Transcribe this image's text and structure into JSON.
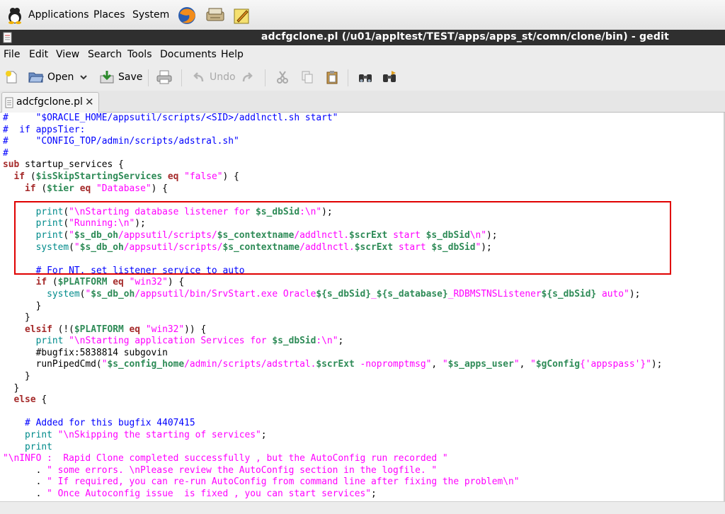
{
  "panel": {
    "menus": [
      "Applications",
      "Places",
      "System"
    ],
    "launchers": [
      "firefox-icon",
      "network-icon",
      "notes-icon"
    ]
  },
  "window": {
    "title": "adcfgclone.pl (/u01/appltest/TEST/apps/apps_st/comn/clone/bin) - gedit"
  },
  "menubar": [
    "File",
    "Edit",
    "View",
    "Search",
    "Tools",
    "Documents",
    "Help"
  ],
  "toolbar": {
    "open_label": "Open",
    "save_label": "Save",
    "undo_label": "Undo"
  },
  "tab": {
    "label": "adcfgclone.pl",
    "close": "✕"
  },
  "code_lines": [
    [
      [
        "c",
        "#     \"$ORACLE_HOME/appsutil/scripts/<SID>/addlnctl.sh start\""
      ]
    ],
    [
      [
        "c",
        "#  if appsTier:"
      ]
    ],
    [
      [
        "c",
        "#     \"CONFIG_TOP/admin/scripts/adstral.sh\""
      ]
    ],
    [
      [
        "c",
        "#"
      ]
    ],
    [
      [
        "k",
        "sub"
      ],
      [
        "n",
        " startup_services {"
      ]
    ],
    [
      [
        "n",
        "  "
      ],
      [
        "k",
        "if"
      ],
      [
        "n",
        " ("
      ],
      [
        "v",
        "$isSkipStartingServices"
      ],
      [
        "n",
        " "
      ],
      [
        "k",
        "eq"
      ],
      [
        "n",
        " "
      ],
      [
        "s",
        "\"false\""
      ],
      [
        "n",
        ") {"
      ]
    ],
    [
      [
        "n",
        "    "
      ],
      [
        "k",
        "if"
      ],
      [
        "n",
        " ("
      ],
      [
        "v",
        "$tier"
      ],
      [
        "n",
        " "
      ],
      [
        "k",
        "eq"
      ],
      [
        "n",
        " "
      ],
      [
        "s",
        "\"Database\""
      ],
      [
        "n",
        ") {"
      ]
    ],
    [
      [
        "n",
        ""
      ]
    ],
    [
      [
        "n",
        "      "
      ],
      [
        "f",
        "print"
      ],
      [
        "n",
        "("
      ],
      [
        "s",
        "\"\\nStarting database listener for "
      ],
      [
        "v",
        "$s_dbSid"
      ],
      [
        "s",
        ":\\n\""
      ],
      [
        "n",
        ");"
      ]
    ],
    [
      [
        "n",
        "      "
      ],
      [
        "f",
        "print"
      ],
      [
        "n",
        "("
      ],
      [
        "s",
        "\"Running:\\n\""
      ],
      [
        "n",
        ");"
      ]
    ],
    [
      [
        "n",
        "      "
      ],
      [
        "f",
        "print"
      ],
      [
        "n",
        "("
      ],
      [
        "s",
        "\""
      ],
      [
        "v",
        "$s_db_oh"
      ],
      [
        "s",
        "/appsutil/scripts/"
      ],
      [
        "v",
        "$s_contextname"
      ],
      [
        "s",
        "/addlnctl."
      ],
      [
        "v",
        "$scrExt"
      ],
      [
        "s",
        " start "
      ],
      [
        "v",
        "$s_dbSid"
      ],
      [
        "s",
        "\\n\""
      ],
      [
        "n",
        ");"
      ]
    ],
    [
      [
        "n",
        "      "
      ],
      [
        "f",
        "system"
      ],
      [
        "n",
        "("
      ],
      [
        "s",
        "\""
      ],
      [
        "v",
        "$s_db_oh"
      ],
      [
        "s",
        "/appsutil/scripts/"
      ],
      [
        "v",
        "$s_contextname"
      ],
      [
        "s",
        "/addlnctl."
      ],
      [
        "v",
        "$scrExt"
      ],
      [
        "s",
        " start "
      ],
      [
        "v",
        "$s_dbSid"
      ],
      [
        "s",
        "\""
      ],
      [
        "n",
        ");"
      ]
    ],
    [
      [
        "n",
        ""
      ]
    ],
    [
      [
        "n",
        "      "
      ],
      [
        "c",
        "# For NT, set listener service to auto"
      ]
    ],
    [
      [
        "n",
        "      "
      ],
      [
        "k",
        "if"
      ],
      [
        "n",
        " ("
      ],
      [
        "v",
        "$PLATFORM"
      ],
      [
        "n",
        " "
      ],
      [
        "k",
        "eq"
      ],
      [
        "n",
        " "
      ],
      [
        "s",
        "\"win32\""
      ],
      [
        "n",
        ") {"
      ]
    ],
    [
      [
        "n",
        "        "
      ],
      [
        "f",
        "system"
      ],
      [
        "n",
        "("
      ],
      [
        "s",
        "\""
      ],
      [
        "v",
        "$s_db_oh"
      ],
      [
        "s",
        "/appsutil/bin/SrvStart.exe Oracle"
      ],
      [
        "v",
        "${s_dbSid}"
      ],
      [
        "s",
        "_"
      ],
      [
        "v",
        "${s_database}"
      ],
      [
        "s",
        "_RDBMSTNSListener"
      ],
      [
        "v",
        "${s_dbSid}"
      ],
      [
        "s",
        " auto\""
      ],
      [
        "n",
        ");"
      ]
    ],
    [
      [
        "n",
        "      }"
      ]
    ],
    [
      [
        "n",
        "    }"
      ]
    ],
    [
      [
        "n",
        "    "
      ],
      [
        "k",
        "elsif"
      ],
      [
        "n",
        " (!("
      ],
      [
        "v",
        "$PLATFORM"
      ],
      [
        "n",
        " "
      ],
      [
        "k",
        "eq"
      ],
      [
        "n",
        " "
      ],
      [
        "s",
        "\"win32\""
      ],
      [
        "n",
        ")) {"
      ]
    ],
    [
      [
        "n",
        "      "
      ],
      [
        "f",
        "print"
      ],
      [
        "n",
        " "
      ],
      [
        "s",
        "\"\\nStarting application Services for "
      ],
      [
        "v",
        "$s_dbSid"
      ],
      [
        "s",
        ":\\n\""
      ],
      [
        "n",
        ";"
      ]
    ],
    [
      [
        "n",
        "      "
      ],
      [
        "n",
        "#bugfix:5838814 subgovin"
      ]
    ],
    [
      [
        "n",
        "      runPipedCmd("
      ],
      [
        "s",
        "\""
      ],
      [
        "v",
        "$s_config_home"
      ],
      [
        "s",
        "/admin/scripts/adstrtal."
      ],
      [
        "v",
        "$scrExt"
      ],
      [
        "s",
        " -nopromptmsg\""
      ],
      [
        "n",
        ", "
      ],
      [
        "s",
        "\""
      ],
      [
        "v",
        "$s_apps_user"
      ],
      [
        "s",
        "\""
      ],
      [
        "n",
        ", "
      ],
      [
        "s",
        "\""
      ],
      [
        "v",
        "$gConfig"
      ],
      [
        "s",
        "{'appspass'}\""
      ],
      [
        "n",
        ");"
      ]
    ],
    [
      [
        "n",
        "    }"
      ]
    ],
    [
      [
        "n",
        "  }"
      ]
    ],
    [
      [
        "n",
        "  "
      ],
      [
        "k",
        "else"
      ],
      [
        "n",
        " {"
      ]
    ],
    [
      [
        "n",
        ""
      ]
    ],
    [
      [
        "n",
        "    "
      ],
      [
        "c",
        "# Added for this bugfix 4407415"
      ]
    ],
    [
      [
        "n",
        "    "
      ],
      [
        "f",
        "print"
      ],
      [
        "n",
        " "
      ],
      [
        "s",
        "\"\\nSkipping the starting of services\""
      ],
      [
        "n",
        ";"
      ]
    ],
    [
      [
        "n",
        "    "
      ],
      [
        "f",
        "print"
      ]
    ],
    [
      [
        "s",
        "\"\\nINFO :  Rapid Clone completed successfully , but the AutoConfig run recorded \""
      ]
    ],
    [
      [
        "n",
        "      . "
      ],
      [
        "s",
        "\" some errors. \\nPlease review the AutoConfig section in the logfile. \""
      ]
    ],
    [
      [
        "n",
        "      . "
      ],
      [
        "s",
        "\" If required, you can re-run AutoConfig from command line after fixing the problem\\n\""
      ]
    ],
    [
      [
        "n",
        "      . "
      ],
      [
        "s",
        "\" Once Autoconfig issue  is fixed , you can start services\""
      ],
      [
        "n",
        ";"
      ]
    ],
    [
      [
        "n",
        "  }"
      ]
    ]
  ]
}
